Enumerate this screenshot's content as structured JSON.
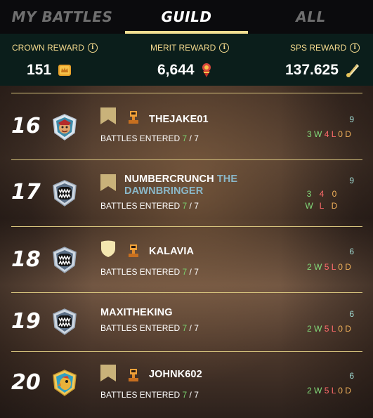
{
  "tabs": [
    {
      "label": "MY BATTLES",
      "active": false
    },
    {
      "label": "GUILD",
      "active": true
    },
    {
      "label": "ALL",
      "active": false
    }
  ],
  "rewards": {
    "crown": {
      "label": "CROWN REWARD",
      "value": "151",
      "icon": "crown-token-icon"
    },
    "merit": {
      "label": "MERIT REWARD",
      "value": "6,644",
      "icon": "merit-icon"
    },
    "sps": {
      "label": "SPS REWARD",
      "value": "137.625",
      "icon": "sps-token-icon"
    }
  },
  "battles_label": "BATTLES ENTERED",
  "players": [
    {
      "rank": "16",
      "name": "THEJAKE01",
      "title": "",
      "entered": "7",
      "total": "7",
      "score": "9",
      "w": "3",
      "l": "4",
      "d": "0",
      "banner": "flag",
      "trophy": true,
      "avatar": "jester-avatar"
    },
    {
      "rank": "17",
      "name": "NUMBERCRUNCH",
      "title": "THE DAWNBRINGER",
      "entered": "7",
      "total": "7",
      "score": "9",
      "w": "3",
      "l": "4",
      "d": "0",
      "banner": "flag",
      "trophy": false,
      "avatar": "monster-avatar"
    },
    {
      "rank": "18",
      "name": "KALAVIA",
      "title": "",
      "entered": "7",
      "total": "7",
      "score": "6",
      "w": "2",
      "l": "5",
      "d": "0",
      "banner": "shield",
      "trophy": true,
      "avatar": "monster-avatar"
    },
    {
      "rank": "19",
      "name": "MAXITHEKING",
      "title": "",
      "entered": "7",
      "total": "7",
      "score": "6",
      "w": "2",
      "l": "5",
      "d": "0",
      "banner": "none",
      "trophy": false,
      "avatar": "monster-avatar"
    },
    {
      "rank": "20",
      "name": "JOHNK602",
      "title": "",
      "entered": "7",
      "total": "7",
      "score": "6",
      "w": "2",
      "l": "5",
      "d": "0",
      "banner": "flag",
      "trophy": true,
      "avatar": "parrot-avatar"
    }
  ],
  "colors": {
    "accent": "#f1dd91",
    "win": "#82d979",
    "loss": "#ff6b6b",
    "draw": "#f0b05a",
    "score": "#9fd9d2"
  }
}
